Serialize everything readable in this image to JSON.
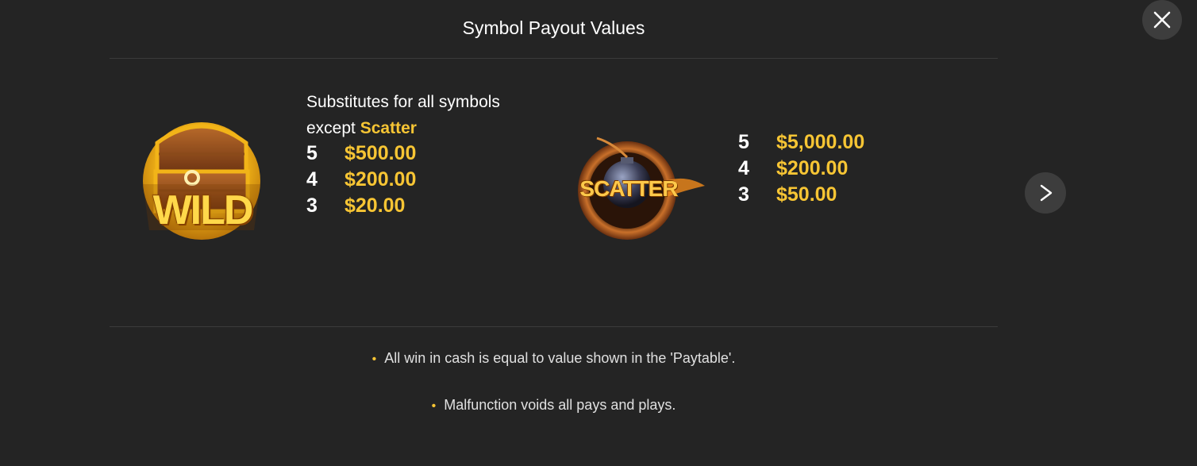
{
  "header": {
    "title": "Symbol Payout Values"
  },
  "wild": {
    "icon": "wild-treasure-chest-icon",
    "logo_text": "WILD",
    "description_line1": "Substitutes for all symbols",
    "description_line2_prefix": "except",
    "description_highlight": "Scatter",
    "payouts": [
      {
        "count": "5",
        "amount": "$500.00"
      },
      {
        "count": "4",
        "amount": "$200.00"
      },
      {
        "count": "3",
        "amount": "$20.00"
      }
    ]
  },
  "scatter": {
    "icon": "scatter-bomb-icon",
    "logo_text": "SCATTER",
    "payouts": [
      {
        "count": "5",
        "amount": "$5,000.00"
      },
      {
        "count": "4",
        "amount": "$200.00"
      },
      {
        "count": "3",
        "amount": "$50.00"
      }
    ]
  },
  "notes": [
    "All win in cash is equal to value shown in the 'Paytable'.",
    "Malfunction voids all pays and plays."
  ],
  "controls": {
    "close_icon": "close-icon",
    "next_icon": "chevron-right-icon"
  },
  "colors": {
    "background": "#242424",
    "accent": "#f7c534",
    "button_bg": "#3d3d3d"
  }
}
